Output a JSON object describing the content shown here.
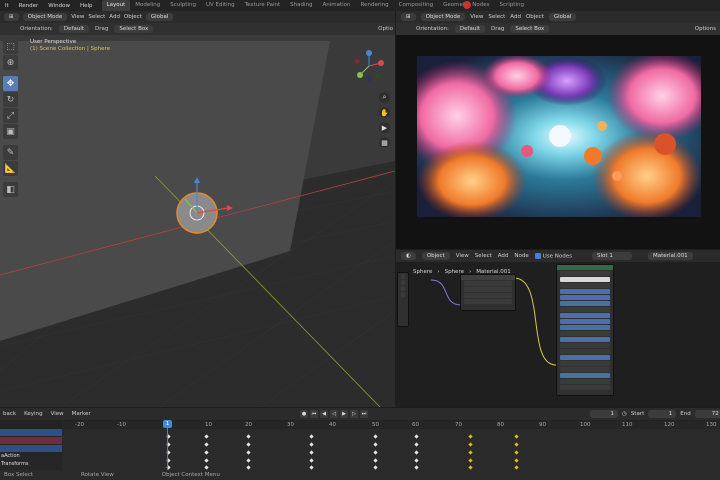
{
  "menu": [
    "lt",
    "Render",
    "Window",
    "Help"
  ],
  "workspace_tabs": [
    {
      "label": "Layout",
      "active": true
    },
    {
      "label": "Modeling"
    },
    {
      "label": "Sculpting"
    },
    {
      "label": "UV Editing"
    },
    {
      "label": "Texture Paint"
    },
    {
      "label": "Shading"
    },
    {
      "label": "Animation"
    },
    {
      "label": "Rendering"
    },
    {
      "label": "Compositing"
    },
    {
      "label": "Geometry Nodes"
    },
    {
      "label": "Scripting"
    }
  ],
  "viewport": {
    "mode": "Object Mode",
    "menus": [
      "View",
      "Select",
      "Add",
      "Object"
    ],
    "transform": "Global",
    "orientation_label": "Orientation:",
    "orientation_value": "Default",
    "drag_label": "Drag",
    "drag_value": "Select Box",
    "options_label": "Optio",
    "perspective": "User Perspective",
    "collection": "(1) Scene Collection | Sphere"
  },
  "image_editor": {
    "mode": "Object Mode",
    "menus": [
      "View",
      "Select",
      "Add",
      "Object"
    ],
    "transform": "Global",
    "orientation_label": "Orientation:",
    "orientation_value": "Default",
    "drag_label": "Drag",
    "drag_value": "Select Box",
    "options_label": "Options"
  },
  "node_editor": {
    "type": "Object",
    "menus": [
      "View",
      "Select",
      "Add",
      "Node"
    ],
    "use_nodes_label": "Use Nodes",
    "slot": "Slot 1",
    "material": "Material.001",
    "breadcrumb": [
      "Sphere",
      "Sphere",
      "Material.001"
    ]
  },
  "timeline": {
    "menus": [
      "back",
      "Keying",
      "View",
      "Marker"
    ],
    "current_frame": "1",
    "start_label": "Start",
    "start_value": "1",
    "end_label": "End",
    "end_value": "72",
    "ruler": [
      "-20",
      "-10",
      "1",
      "10",
      "20",
      "30",
      "40",
      "50",
      "60",
      "70",
      "80",
      "90",
      "100",
      "110",
      "120",
      "130"
    ],
    "channels": [
      "",
      "",
      "",
      "",
      "aAction",
      "Transforms"
    ]
  },
  "status": [
    "Box Select",
    "Rotate View",
    "Object Context Menu"
  ],
  "colors": {
    "accent_blue": "#4a86d8",
    "close_red": "#c8342f",
    "keyframe_white": "#e8e8e8",
    "keyframe_yellow": "#e3b32a"
  }
}
